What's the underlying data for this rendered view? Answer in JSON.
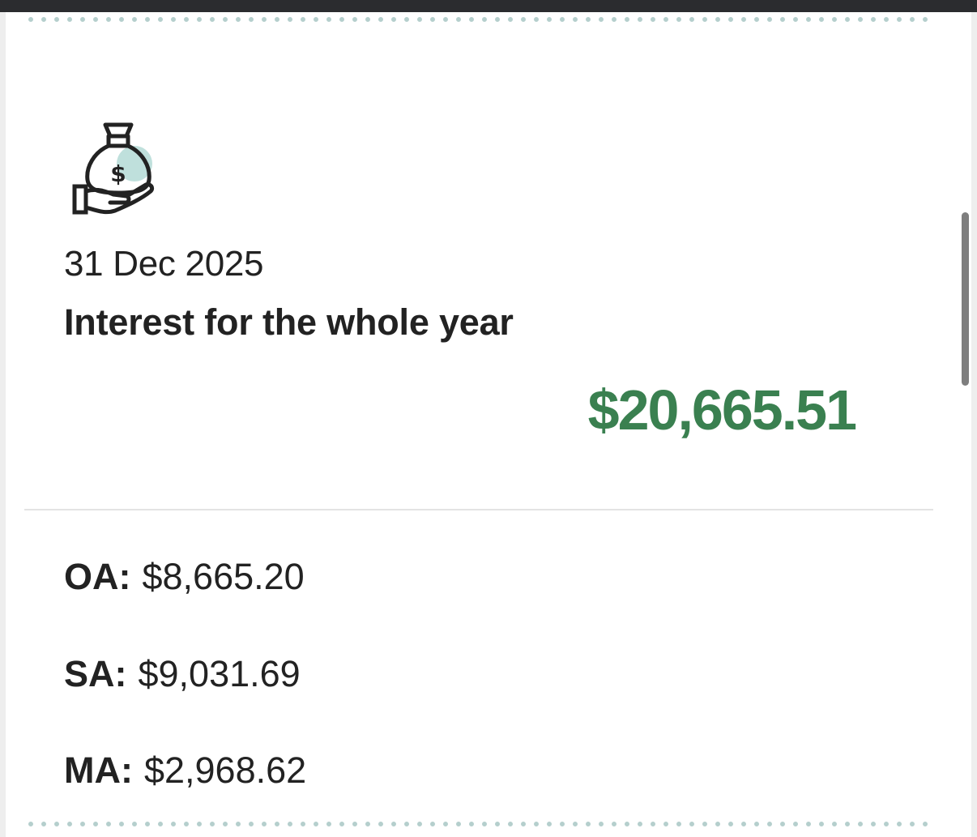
{
  "card": {
    "icon": "money-bag-hand-icon",
    "date": "31 Dec 2025",
    "title": "Interest for the whole year",
    "total": "$20,665.51",
    "accounts": [
      {
        "label": "OA:",
        "value": "$8,665.20"
      },
      {
        "label": "SA:",
        "value": "$9,031.69"
      },
      {
        "label": "MA:",
        "value": "$2,968.62"
      }
    ]
  },
  "colors": {
    "accent_green": "#3a8050",
    "icon_tint": "#bfe0dc",
    "dots": "#b5cfcd",
    "text": "#222222"
  }
}
